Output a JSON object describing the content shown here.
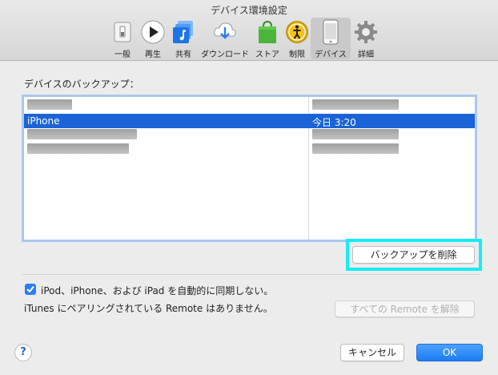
{
  "window": {
    "title": "デバイス環境設定"
  },
  "toolbar": {
    "items": [
      {
        "label": "一般",
        "icon": "switch-icon"
      },
      {
        "label": "再生",
        "icon": "play-icon"
      },
      {
        "label": "共有",
        "icon": "music-note-icon"
      },
      {
        "label": "ダウンロード",
        "icon": "cloud-download-icon"
      },
      {
        "label": "ストア",
        "icon": "shopping-bag-icon"
      },
      {
        "label": "制限",
        "icon": "restriction-icon"
      },
      {
        "label": "デバイス",
        "icon": "iphone-icon",
        "active": true
      },
      {
        "label": "詳細",
        "icon": "gear-icon"
      }
    ]
  },
  "backups": {
    "label": "デバイスのバックアップ：",
    "rows": [
      {
        "name": "",
        "date": "",
        "redacted": true
      },
      {
        "name": "iPhone",
        "date": "今日 3:20",
        "selected": true
      },
      {
        "name": "",
        "date": "",
        "redacted": true
      },
      {
        "name": "",
        "date": "",
        "redacted": true
      }
    ],
    "delete_button": "バックアップを削除"
  },
  "sync": {
    "checkbox_label": "iPod、iPhone、および iPad を自動的に同期しない。",
    "checked": true
  },
  "remote": {
    "note": "iTunes にペアリングされている Remote はありません。",
    "unpair_button": "すべての Remote を解除"
  },
  "footer": {
    "help": "?",
    "cancel": "キャンセル",
    "ok": "OK"
  },
  "colors": {
    "selection": "#1b63d6",
    "primary_button": "#1b7cf5",
    "highlight_border": "#18ecf4"
  }
}
